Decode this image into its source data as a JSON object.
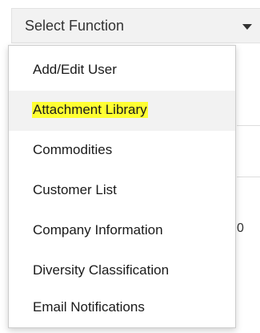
{
  "select": {
    "label": "Select Function",
    "caret_icon": "triangle-down-icon"
  },
  "menu": {
    "items": [
      {
        "label": "Add/Edit User"
      },
      {
        "label": "Attachment Library",
        "highlight_color": "#ffff33",
        "active": true
      },
      {
        "label": "Commodities"
      },
      {
        "label": "Customer List"
      },
      {
        "label": "Company Information"
      },
      {
        "label": "Diversity Classification"
      },
      {
        "label": "Email Notifications"
      }
    ]
  },
  "background": {
    "partial_text": "0"
  },
  "colors": {
    "select_bg": "#f2f2f2",
    "active_item_bg": "#f2f2f2",
    "highlight": "#ffff33",
    "text": "#1a1a1a"
  }
}
